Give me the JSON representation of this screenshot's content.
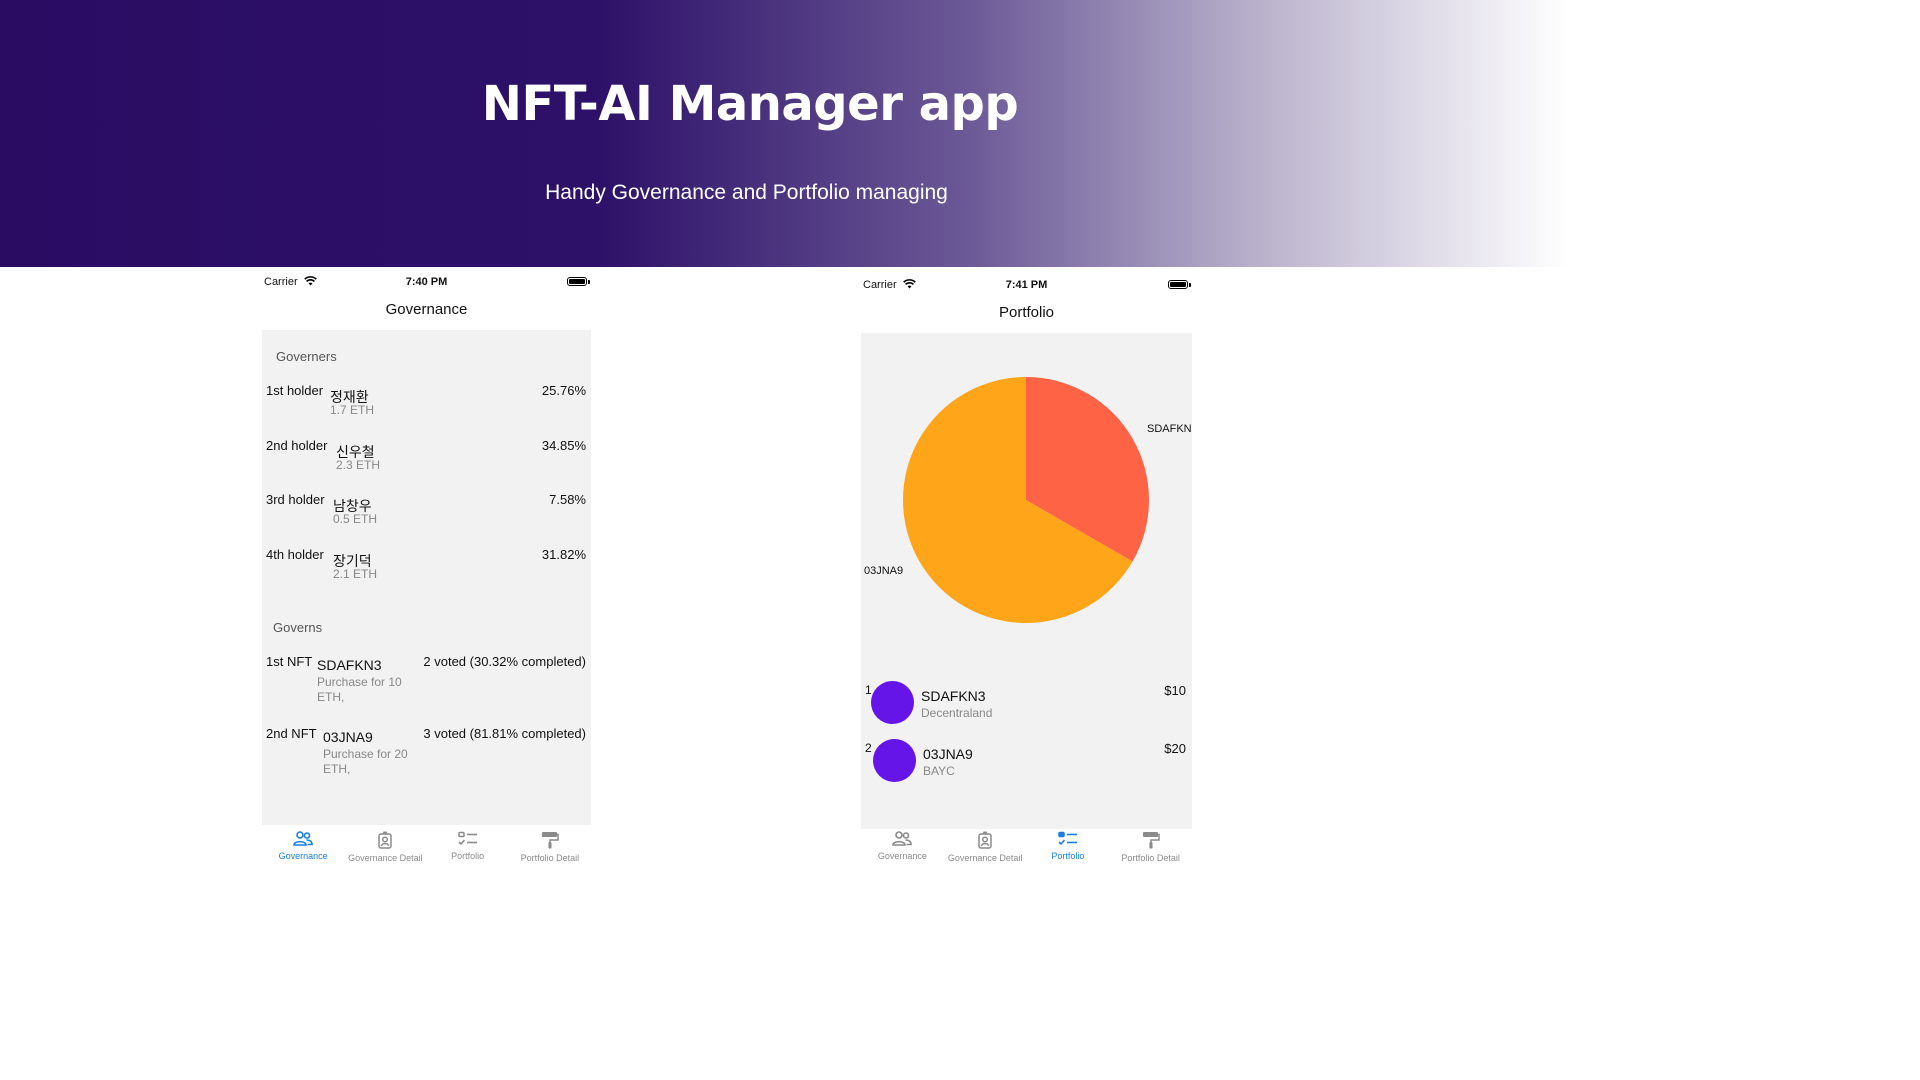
{
  "hero": {
    "title": "NFT-AI Manager app",
    "subtitle": "Handy Governance and Portfolio managing"
  },
  "left_phone": {
    "status": {
      "carrier": "Carrier",
      "time": "7:40 PM"
    },
    "title": "Governance",
    "governers_header": "Governers",
    "governers": [
      {
        "rank": "1st holder",
        "name": "정재환",
        "amount": "1.7 ETH",
        "percent": "25.76%"
      },
      {
        "rank": "2nd holder",
        "name": "신우철",
        "amount": "2.3 ETH",
        "percent": "34.85%"
      },
      {
        "rank": "3rd holder",
        "name": "남창우",
        "amount": "0.5 ETH",
        "percent": "7.58%"
      },
      {
        "rank": "4th holder",
        "name": "장기덕",
        "amount": "2.1 ETH",
        "percent": "31.82%"
      }
    ],
    "governs_header": "Governs",
    "governs": [
      {
        "rank": "1st NFT",
        "name": "SDAFKN3",
        "desc_line1": "Purchase for 10",
        "desc_line2": "ETH,",
        "status": "2 voted (30.32% completed)"
      },
      {
        "rank": "2nd NFT",
        "name": "03JNA9",
        "desc_line1": "Purchase for 20",
        "desc_line2": "ETH,",
        "status": "3 voted (81.81% completed)"
      }
    ],
    "tabs": [
      {
        "label": "Governance",
        "icon": "people-icon",
        "active": true
      },
      {
        "label": "Governance Detail",
        "icon": "person-badge-icon",
        "active": false
      },
      {
        "label": "Portfolio",
        "icon": "checklist-icon",
        "active": false
      },
      {
        "label": "Portfolio Detail",
        "icon": "paint-roller-icon",
        "active": false
      }
    ]
  },
  "right_phone": {
    "status": {
      "carrier": "Carrier",
      "time": "7:41 PM"
    },
    "title": "Portfolio",
    "chart_data": {
      "type": "pie",
      "slices": [
        {
          "label": "SDAFKN3",
          "display_label": "SDAFKN",
          "value": 10,
          "color": "#fe6346"
        },
        {
          "label": "03JNA9",
          "display_label": "03JNA9",
          "value": 20,
          "color": "#fea519"
        }
      ]
    },
    "items": [
      {
        "index": "1",
        "name": "SDAFKN3",
        "collection": "Decentraland",
        "price": "$10",
        "color": "#6615e8"
      },
      {
        "index": "2",
        "name": "03JNA9",
        "collection": "BAYC",
        "price": "$20",
        "color": "#6615e8"
      }
    ],
    "tabs": [
      {
        "label": "Governance",
        "icon": "people-icon",
        "active": false
      },
      {
        "label": "Governance Detail",
        "icon": "person-badge-icon",
        "active": false
      },
      {
        "label": "Portfolio",
        "icon": "checklist-icon",
        "active": true
      },
      {
        "label": "Portfolio Detail",
        "icon": "paint-roller-icon",
        "active": false
      }
    ]
  }
}
